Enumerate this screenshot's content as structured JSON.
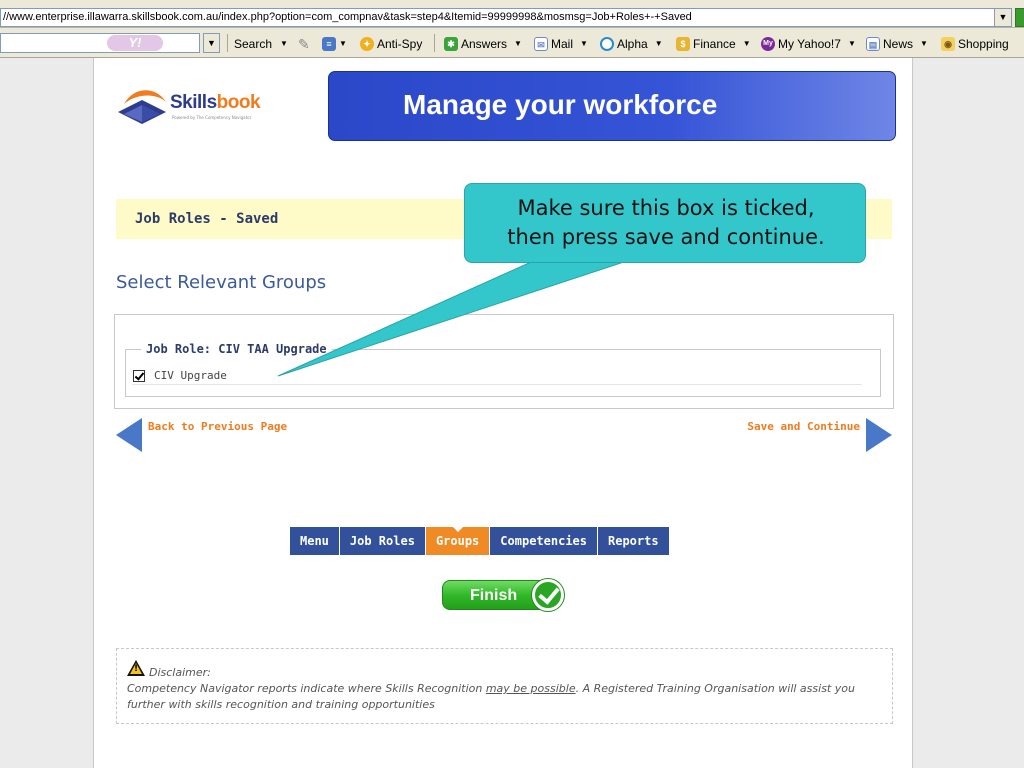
{
  "browser": {
    "url": "//www.enterprise.illawarra.skillsbook.com.au/index.php?option=com_compnav&task=step4&Itemid=99999998&mosmsg=Job+Roles+-+Saved",
    "toolbar": {
      "search_label": "Search",
      "antispy_label": "Anti-Spy",
      "answers_label": "Answers",
      "mail_label": "Mail",
      "alpha_label": "Alpha",
      "finance_label": "Finance",
      "myyahoo_label": "My Yahoo!7",
      "news_label": "News",
      "shopping_label": "Shopping",
      "yahoo_logo": "Y!"
    }
  },
  "header": {
    "logo": {
      "part1": "Skills",
      "part2": "book",
      "tagline": "Powered by The Competency Navigator"
    },
    "banner_text": "Manage your workforce"
  },
  "status": {
    "message": "Job Roles - Saved"
  },
  "groups": {
    "title": "Select Relevant Groups",
    "job_role_legend": "Job Role: CIV TAA Upgrade",
    "items": [
      {
        "label": "CIV Upgrade",
        "checked": true
      }
    ]
  },
  "navigation": {
    "back_label": "Back to Previous Page",
    "next_label": "Save and Continue"
  },
  "tabs": {
    "items": [
      {
        "label": "Menu"
      },
      {
        "label": "Job Roles"
      },
      {
        "label": "Groups",
        "active": true
      },
      {
        "label": "Competencies"
      },
      {
        "label": "Reports"
      }
    ]
  },
  "finish": {
    "label": "Finish"
  },
  "disclaimer": {
    "title": "Disclaimer:",
    "text_before": "Competency Navigator reports indicate where Skills Recognition ",
    "text_link": "may be possible",
    "text_after": ". A Registered Training Organisation will assist you further with skills recognition and training opportunities"
  },
  "callout": {
    "line1": "Make sure this box is ticked,",
    "line2": "then press save and continue."
  },
  "colors": {
    "accent_orange": "#f07c1e",
    "nav_blue": "#33519a",
    "callout_teal": "#33c7cc",
    "banner_blue": "#2a48c8"
  }
}
